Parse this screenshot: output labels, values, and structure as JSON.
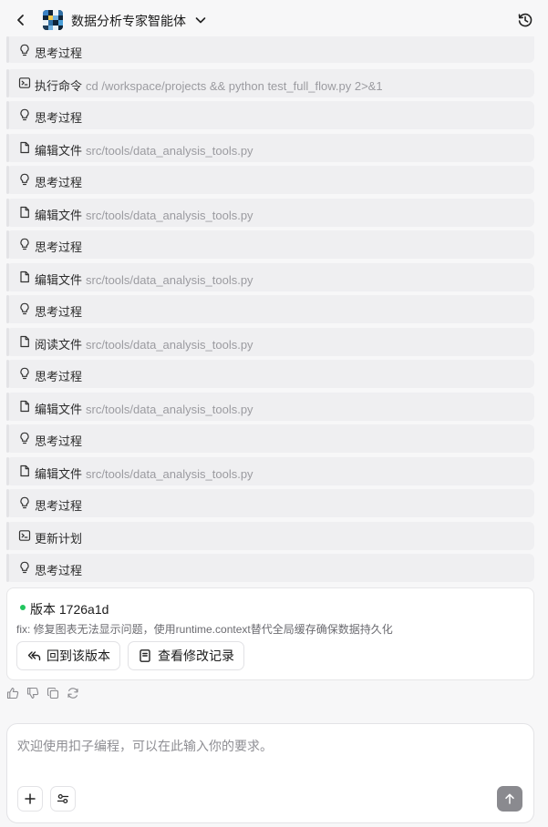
{
  "header": {
    "title": "数据分析专家智能体",
    "back_icon": "chevron-left-icon",
    "dropdown_icon": "chevron-down-icon",
    "history_icon": "history-clock-icon"
  },
  "steps": [
    {
      "icon": "lightbulb-icon",
      "action": "思考过程",
      "target": ""
    },
    {
      "icon": "terminal-icon",
      "action": "执行命令",
      "target": "cd /workspace/projects && python test_full_flow.py 2>&1"
    },
    {
      "icon": "lightbulb-icon",
      "action": "思考过程",
      "target": ""
    },
    {
      "icon": "file-icon",
      "action": "编辑文件",
      "target": "src/tools/data_analysis_tools.py"
    },
    {
      "icon": "lightbulb-icon",
      "action": "思考过程",
      "target": ""
    },
    {
      "icon": "file-icon",
      "action": "编辑文件",
      "target": "src/tools/data_analysis_tools.py"
    },
    {
      "icon": "lightbulb-icon",
      "action": "思考过程",
      "target": ""
    },
    {
      "icon": "file-icon",
      "action": "编辑文件",
      "target": "src/tools/data_analysis_tools.py"
    },
    {
      "icon": "lightbulb-icon",
      "action": "思考过程",
      "target": ""
    },
    {
      "icon": "file-icon",
      "action": "阅读文件",
      "target": "src/tools/data_analysis_tools.py"
    },
    {
      "icon": "lightbulb-icon",
      "action": "思考过程",
      "target": ""
    },
    {
      "icon": "file-icon",
      "action": "编辑文件",
      "target": "src/tools/data_analysis_tools.py"
    },
    {
      "icon": "lightbulb-icon",
      "action": "思考过程",
      "target": ""
    },
    {
      "icon": "file-icon",
      "action": "编辑文件",
      "target": "src/tools/data_analysis_tools.py"
    },
    {
      "icon": "lightbulb-icon",
      "action": "思考过程",
      "target": ""
    },
    {
      "icon": "terminal-icon",
      "action": "更新计划",
      "target": ""
    },
    {
      "icon": "lightbulb-icon",
      "action": "思考过程",
      "target": ""
    }
  ],
  "version_card": {
    "title": "版本 1726a1d",
    "status_color": "#22c55e",
    "description": "fix: 修复图表无法显示问题，使用runtime.context替代全局缓存确保数据持久化",
    "revert_label": "回到该版本",
    "log_label": "查看修改记录"
  },
  "feedback_icons": [
    "thumbs-up-icon",
    "thumbs-down-icon",
    "copy-icon",
    "regenerate-icon"
  ],
  "composer": {
    "placeholder": "欢迎使用扣子编程，可以在此输入你的要求。",
    "value": "",
    "add_icon": "plus-icon",
    "tools_icon": "settings-sliders-icon",
    "send_icon": "arrow-up-icon"
  }
}
